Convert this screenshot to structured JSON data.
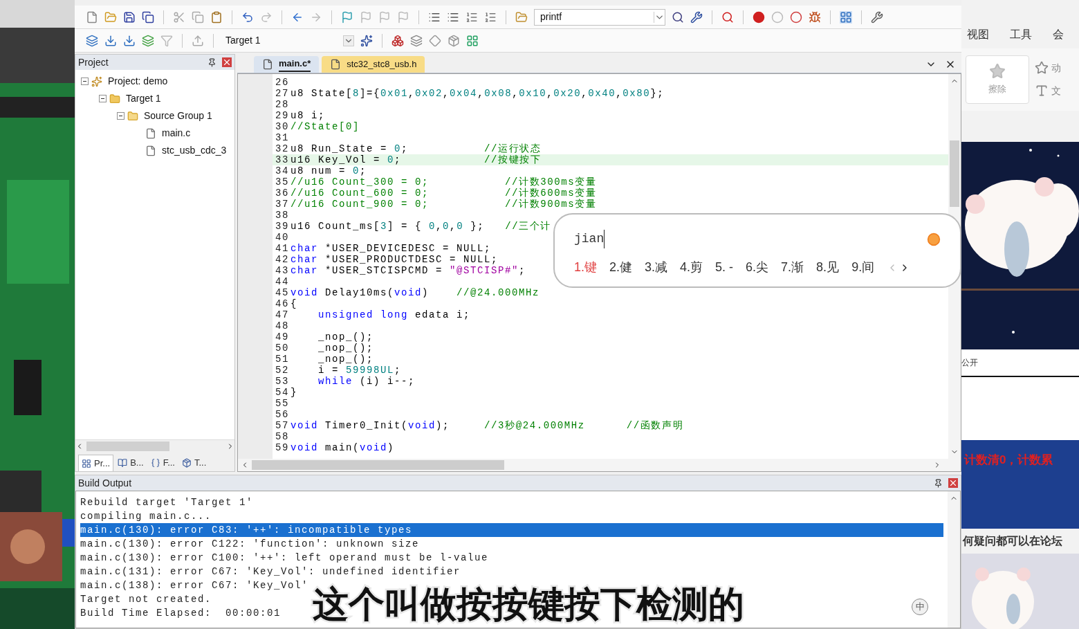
{
  "toolbar": {
    "find_field": "printf",
    "target_select": "Target 1"
  },
  "project_panel": {
    "title": "Project",
    "tree": [
      {
        "label": "Project: demo",
        "kind": "project",
        "expanded": true,
        "children": [
          {
            "label": "Target 1",
            "kind": "target",
            "expanded": true,
            "children": [
              {
                "label": "Source Group 1",
                "kind": "group",
                "expanded": true,
                "children": [
                  {
                    "label": "main.c",
                    "kind": "file"
                  },
                  {
                    "label": "stc_usb_cdc_3",
                    "kind": "file"
                  }
                ]
              }
            ]
          }
        ]
      }
    ],
    "tabs": [
      {
        "label": "Pr...",
        "kind": "project",
        "selected": true
      },
      {
        "label": "B...",
        "kind": "books",
        "selected": false
      },
      {
        "label": "F...",
        "kind": "functions",
        "selected": false
      },
      {
        "label": "T...",
        "kind": "templates",
        "selected": false
      }
    ]
  },
  "editor": {
    "tabs": [
      {
        "label": "main.c*",
        "selected": true
      },
      {
        "label": "stc32_stc8_usb.h",
        "selected": false
      }
    ],
    "lines": [
      {
        "num": "26",
        "current": false
      },
      {
        "num": "27",
        "current": false,
        "segments": [
          {
            "kind": "plain",
            "text": "u8 State["
          },
          {
            "kind": "number",
            "text": "8"
          },
          {
            "kind": "plain",
            "text": "]={"
          },
          {
            "kind": "number",
            "text": "0x01"
          },
          {
            "kind": "plain",
            "text": ","
          },
          {
            "kind": "number",
            "text": "0x02"
          },
          {
            "kind": "plain",
            "text": ","
          },
          {
            "kind": "number",
            "text": "0x04"
          },
          {
            "kind": "plain",
            "text": ","
          },
          {
            "kind": "number",
            "text": "0x08"
          },
          {
            "kind": "plain",
            "text": ","
          },
          {
            "kind": "number",
            "text": "0x10"
          },
          {
            "kind": "plain",
            "text": ","
          },
          {
            "kind": "number",
            "text": "0x20"
          },
          {
            "kind": "plain",
            "text": ","
          },
          {
            "kind": "number",
            "text": "0x40"
          },
          {
            "kind": "plain",
            "text": ","
          },
          {
            "kind": "number",
            "text": "0x80"
          },
          {
            "kind": "plain",
            "text": "};"
          }
        ]
      },
      {
        "num": "28",
        "current": false
      },
      {
        "num": "29",
        "current": false,
        "segments": [
          {
            "kind": "plain",
            "text": "u8 i;"
          }
        ]
      },
      {
        "num": "30",
        "current": false,
        "segments": [
          {
            "kind": "comment",
            "text": "//State[0]"
          }
        ]
      },
      {
        "num": "31",
        "current": false
      },
      {
        "num": "32",
        "current": false,
        "segments": [
          {
            "kind": "plain",
            "text": "u8 Run_State = "
          },
          {
            "kind": "number",
            "text": "0"
          },
          {
            "kind": "plain",
            "text": ";           "
          },
          {
            "kind": "comment",
            "text": "//运行状态"
          }
        ]
      },
      {
        "num": "33",
        "current": true,
        "segments": [
          {
            "kind": "plain",
            "text": "u16 Key_Vol = "
          },
          {
            "kind": "number",
            "text": "0"
          },
          {
            "kind": "plain",
            "text": ";            "
          },
          {
            "kind": "comment",
            "text": "//按键按下"
          }
        ]
      },
      {
        "num": "34",
        "current": false,
        "segments": [
          {
            "kind": "plain",
            "text": "u8 num = "
          },
          {
            "kind": "number",
            "text": "0"
          },
          {
            "kind": "plain",
            "text": ";"
          }
        ]
      },
      {
        "num": "35",
        "current": false,
        "segments": [
          {
            "kind": "comment",
            "text": "//u16 Count_300 = 0;           //计数300ms变量"
          }
        ]
      },
      {
        "num": "36",
        "current": false,
        "segments": [
          {
            "kind": "comment",
            "text": "//u16 Count_600 = 0;           //计数600ms变量"
          }
        ]
      },
      {
        "num": "37",
        "current": false,
        "segments": [
          {
            "kind": "comment",
            "text": "//u16 Count_900 = 0;           //计数900ms变量"
          }
        ]
      },
      {
        "num": "38",
        "current": false
      },
      {
        "num": "39",
        "current": false,
        "segments": [
          {
            "kind": "plain",
            "text": "u16 Count_ms["
          },
          {
            "kind": "number",
            "text": "3"
          },
          {
            "kind": "plain",
            "text": "] = { "
          },
          {
            "kind": "number",
            "text": "0"
          },
          {
            "kind": "plain",
            "text": ","
          },
          {
            "kind": "number",
            "text": "0"
          },
          {
            "kind": "plain",
            "text": ","
          },
          {
            "kind": "number",
            "text": "0"
          },
          {
            "kind": "plain",
            "text": " };   "
          },
          {
            "kind": "comment",
            "text": "//三个计"
          }
        ]
      },
      {
        "num": "40",
        "current": false
      },
      {
        "num": "41",
        "current": false,
        "segments": [
          {
            "kind": "keyword",
            "text": "char"
          },
          {
            "kind": "plain",
            "text": " *USER_DEVICEDESC = NULL;"
          }
        ]
      },
      {
        "num": "42",
        "current": false,
        "segments": [
          {
            "kind": "keyword",
            "text": "char"
          },
          {
            "kind": "plain",
            "text": " *USER_PRODUCTDESC = NULL;"
          }
        ]
      },
      {
        "num": "43",
        "current": false,
        "segments": [
          {
            "kind": "keyword",
            "text": "char"
          },
          {
            "kind": "plain",
            "text": " *USER_STCISPCMD = "
          },
          {
            "kind": "string",
            "text": "\"@STCISP#\""
          },
          {
            "kind": "plain",
            "text": ";"
          }
        ]
      },
      {
        "num": "44",
        "current": false
      },
      {
        "num": "45",
        "current": false,
        "segments": [
          {
            "kind": "keyword",
            "text": "void"
          },
          {
            "kind": "plain",
            "text": " Delay10ms("
          },
          {
            "kind": "keyword",
            "text": "void"
          },
          {
            "kind": "plain",
            "text": ")    "
          },
          {
            "kind": "comment",
            "text": "//@24.000MHz"
          }
        ]
      },
      {
        "num": "46",
        "current": false,
        "segments": [
          {
            "kind": "plain",
            "text": "{"
          }
        ]
      },
      {
        "num": "47",
        "current": false,
        "segments": [
          {
            "kind": "keyword",
            "text": "    unsigned long"
          },
          {
            "kind": "plain",
            "text": " edata i;"
          }
        ]
      },
      {
        "num": "48",
        "current": false
      },
      {
        "num": "49",
        "current": false,
        "segments": [
          {
            "kind": "plain",
            "text": "    _nop_();"
          }
        ]
      },
      {
        "num": "50",
        "current": false,
        "segments": [
          {
            "kind": "plain",
            "text": "    _nop_();"
          }
        ]
      },
      {
        "num": "51",
        "current": false,
        "segments": [
          {
            "kind": "plain",
            "text": "    _nop_();"
          }
        ]
      },
      {
        "num": "52",
        "current": false,
        "segments": [
          {
            "kind": "plain",
            "text": "    i = "
          },
          {
            "kind": "number",
            "text": "59998UL"
          },
          {
            "kind": "plain",
            "text": ";"
          }
        ]
      },
      {
        "num": "53",
        "current": false,
        "segments": [
          {
            "kind": "keyword",
            "text": "    while"
          },
          {
            "kind": "plain",
            "text": " (i) i--;"
          }
        ]
      },
      {
        "num": "54",
        "current": false,
        "segments": [
          {
            "kind": "plain",
            "text": "}"
          }
        ]
      },
      {
        "num": "55",
        "current": false
      },
      {
        "num": "56",
        "current": false
      },
      {
        "num": "57",
        "current": false,
        "segments": [
          {
            "kind": "keyword",
            "text": "void"
          },
          {
            "kind": "plain",
            "text": " Timer0_Init("
          },
          {
            "kind": "keyword",
            "text": "void"
          },
          {
            "kind": "plain",
            "text": ");     "
          },
          {
            "kind": "comment",
            "text": "//3秒@24.000MHz      //函数声明"
          }
        ]
      },
      {
        "num": "58",
        "current": false
      },
      {
        "num": "59",
        "current": false,
        "segments": [
          {
            "kind": "keyword",
            "text": "void"
          },
          {
            "kind": "plain",
            "text": " main("
          },
          {
            "kind": "keyword",
            "text": "void"
          },
          {
            "kind": "plain",
            "text": ")"
          }
        ]
      }
    ]
  },
  "ime_popup": {
    "input": "jian",
    "candidates": [
      {
        "text": "1.键",
        "selected": true
      },
      {
        "text": "2.健",
        "selected": false
      },
      {
        "text": "3.减",
        "selected": false
      },
      {
        "text": "4.剪",
        "selected": false
      },
      {
        "text": "5. -",
        "selected": false
      },
      {
        "text": "6.尖",
        "selected": false
      },
      {
        "text": "7.渐",
        "selected": false
      },
      {
        "text": "8.见",
        "selected": false
      },
      {
        "text": "9.间",
        "selected": false
      }
    ]
  },
  "build_output": {
    "title": "Build Output",
    "lines": [
      {
        "text": "Rebuild target 'Target 1'",
        "selected": false
      },
      {
        "text": "compiling main.c...",
        "selected": false
      },
      {
        "text": "main.c(130): error C83: '++': incompatible types",
        "selected": true
      },
      {
        "text": "main.c(130): error C122: 'function': unknown size",
        "selected": false
      },
      {
        "text": "main.c(130): error C100: '++': left operand must be l-value",
        "selected": false
      },
      {
        "text": "main.c(131): error C67: 'Key_Vol': undefined identifier",
        "selected": false
      },
      {
        "text": "main.c(138): error C67: 'Key_Vol'",
        "selected": false
      },
      {
        "text": "Target not created.",
        "selected": false
      },
      {
        "text": "Build Time Elapsed:  00:00:01",
        "selected": false
      }
    ]
  },
  "ime_mode": "中",
  "subtitle": "这个叫做按按键按下检测的",
  "side_app": {
    "menu": [
      "视图",
      "工具",
      "会"
    ],
    "ribbon": [
      {
        "label": "擦除",
        "kind": "star"
      },
      {
        "label": "动",
        "kind": "star-outline"
      },
      {
        "label": "文",
        "kind": "text"
      }
    ],
    "slide_note": "公开",
    "slide_red_text": "计数清0，计数累",
    "footer_text": "何疑问都可以在论坛"
  }
}
